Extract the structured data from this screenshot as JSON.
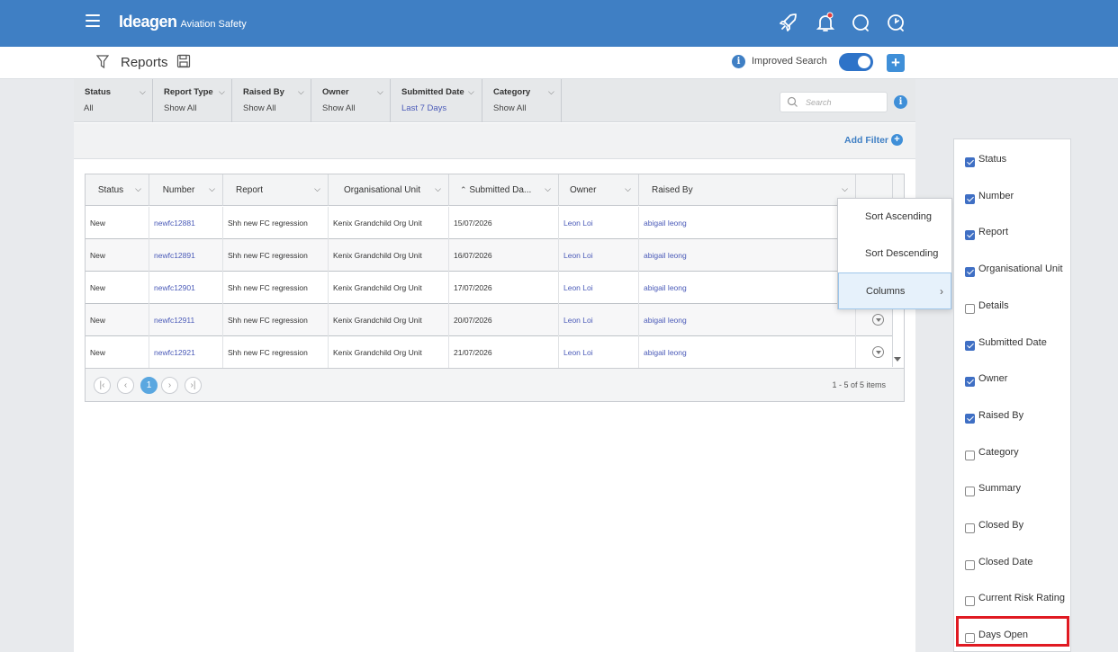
{
  "topbar": {
    "brand": "Ideagen",
    "product": "Aviation Safety",
    "icons": [
      "menu-icon",
      "rocket-icon",
      "bell-icon",
      "chat-icon",
      "help-clock-icon"
    ],
    "brand_color": "#3f7fc4"
  },
  "subbar": {
    "title": "Reports",
    "improved_search_label": "Improved Search",
    "improved_search_on": true,
    "add_label": "+"
  },
  "filters": [
    {
      "label": "Status",
      "value": "All"
    },
    {
      "label": "Report Type",
      "value": "Show All"
    },
    {
      "label": "Raised By",
      "value": "Show All"
    },
    {
      "label": "Owner",
      "value": "Show All"
    },
    {
      "label": "Submitted Date",
      "value": "Last 7 Days"
    },
    {
      "label": "Category",
      "value": "Show All"
    }
  ],
  "search": {
    "placeholder": "Search"
  },
  "add_filter_label": "Add Filter",
  "grid": {
    "headers": [
      "Status",
      "Number",
      "Report",
      "Organisational Unit",
      "Submitted Da...",
      "Owner",
      "Raised By"
    ],
    "rows": [
      [
        "New",
        "newfc12881",
        "Shh new FC regression",
        "Kenix Grandchild Org Unit",
        "15/07/2026",
        "Leon Loi",
        "abigail leong"
      ],
      [
        "New",
        "newfc12891",
        "Shh new FC regression",
        "Kenix Grandchild Org Unit",
        "16/07/2026",
        "Leon Loi",
        "abigail leong"
      ],
      [
        "New",
        "newfc12901",
        "Shh new FC regression",
        "Kenix Grandchild Org Unit",
        "17/07/2026",
        "Leon Loi",
        "abigail leong"
      ],
      [
        "New",
        "newfc12911",
        "Shh new FC regression",
        "Kenix Grandchild Org Unit",
        "20/07/2026",
        "Leon Loi",
        "abigail leong"
      ],
      [
        "New",
        "newfc12921",
        "Shh new FC regression",
        "Kenix Grandchild Org Unit",
        "21/07/2026",
        "Leon Loi",
        "abigail leong"
      ]
    ],
    "pager": {
      "current_page": "1",
      "info": "1 - 5 of 5 items"
    }
  },
  "context_menu": [
    "Sort Ascending",
    "Sort Descending",
    "Columns"
  ],
  "columns_panel": [
    {
      "label": "Status",
      "checked": true
    },
    {
      "label": "Number",
      "checked": true
    },
    {
      "label": "Report",
      "checked": true
    },
    {
      "label": "Organisational Unit",
      "checked": true
    },
    {
      "label": "Details",
      "checked": false
    },
    {
      "label": "Submitted Date",
      "checked": true
    },
    {
      "label": "Owner",
      "checked": true
    },
    {
      "label": "Raised By",
      "checked": true
    },
    {
      "label": "Category",
      "checked": false
    },
    {
      "label": "Summary",
      "checked": false
    },
    {
      "label": "Closed By",
      "checked": false
    },
    {
      "label": "Closed Date",
      "checked": false
    },
    {
      "label": "Current Risk Rating",
      "checked": false
    },
    {
      "label": "Days Open",
      "checked": false
    }
  ]
}
